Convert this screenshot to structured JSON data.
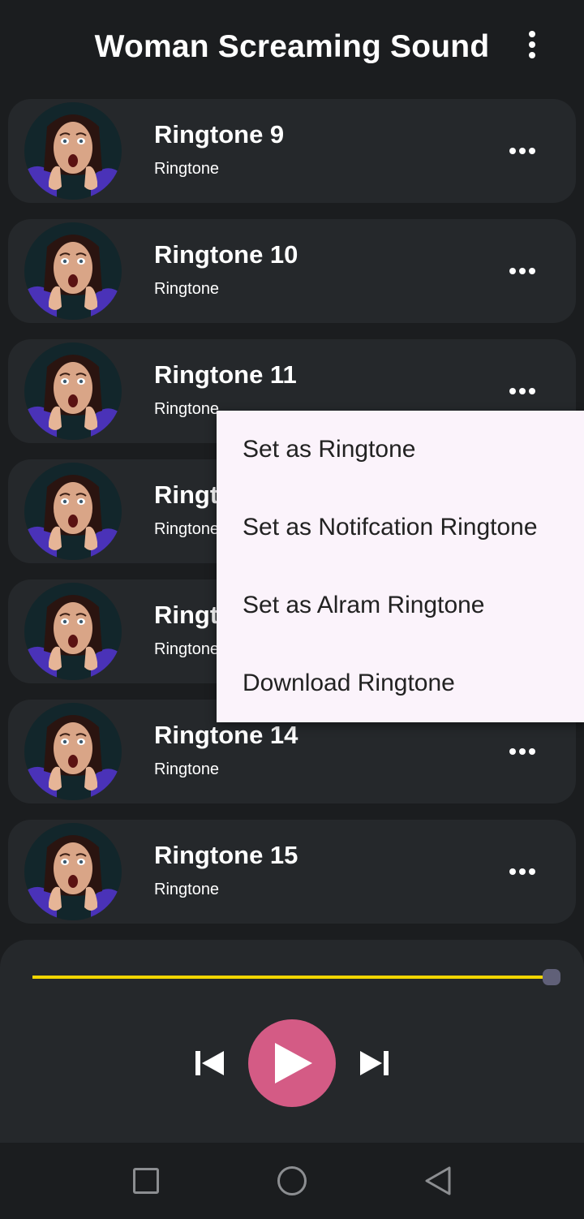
{
  "app": {
    "title": "Woman Screaming Sound"
  },
  "ringtones": [
    {
      "title": "Ringtone 9",
      "subtitle": "Ringtone"
    },
    {
      "title": "Ringtone 10",
      "subtitle": "Ringtone"
    },
    {
      "title": "Ringtone 11",
      "subtitle": "Ringtone"
    },
    {
      "title": "Ringtone 12",
      "subtitle": "Ringtone"
    },
    {
      "title": "Ringtone 13",
      "subtitle": "Ringtone"
    },
    {
      "title": "Ringtone 14",
      "subtitle": "Ringtone"
    },
    {
      "title": "Ringtone 15",
      "subtitle": "Ringtone"
    }
  ],
  "popup_menu": {
    "items": [
      "Set as Ringtone",
      "Set as Notifcation Ringtone",
      "Set as Alram Ringtone",
      "Download Ringtone"
    ]
  },
  "player": {
    "progress": 0.99,
    "accent_color": "#f2d600",
    "play_button_color": "#d45b85"
  },
  "icons": {
    "overflow": "vertical-dots-icon",
    "item_more": "horizontal-dots-icon",
    "prev": "skip-previous-icon",
    "play": "play-icon",
    "next": "skip-next-icon",
    "nav_recent": "square-icon",
    "nav_home": "circle-icon",
    "nav_back": "triangle-back-icon"
  }
}
